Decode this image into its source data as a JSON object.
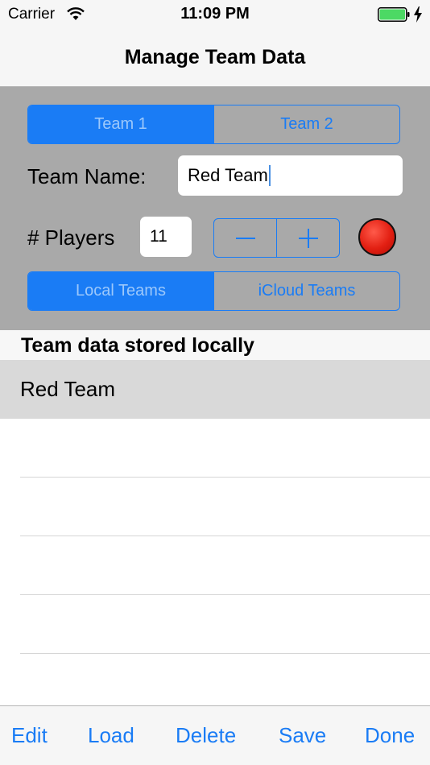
{
  "status_bar": {
    "carrier": "Carrier",
    "time": "11:09 PM",
    "icons": [
      "wifi-icon",
      "battery-icon",
      "charging-bolt-icon"
    ],
    "battery_color": "#4cd964"
  },
  "nav": {
    "title": "Manage Team Data"
  },
  "team_selector": {
    "options": [
      "Team 1",
      "Team 2"
    ],
    "selected": "Team 1"
  },
  "team_name": {
    "label": "Team Name:",
    "value": "Red Team"
  },
  "players": {
    "label": "# Players",
    "value": "11",
    "stepper_icons": [
      "minus-icon",
      "plus-icon"
    ]
  },
  "team_color": "#e21f12",
  "storage_selector": {
    "options": [
      "Local Teams",
      "iCloud Teams"
    ],
    "selected": "Local Teams"
  },
  "section": {
    "title": "Team data stored locally"
  },
  "teams": [
    {
      "name": "Red Team",
      "selected": true
    }
  ],
  "toolbar": {
    "edit": "Edit",
    "load": "Load",
    "delete": "Delete",
    "save": "Save",
    "done": "Done"
  },
  "colors": {
    "accent": "#1a7cf5",
    "panel": "#a9a9a9"
  }
}
